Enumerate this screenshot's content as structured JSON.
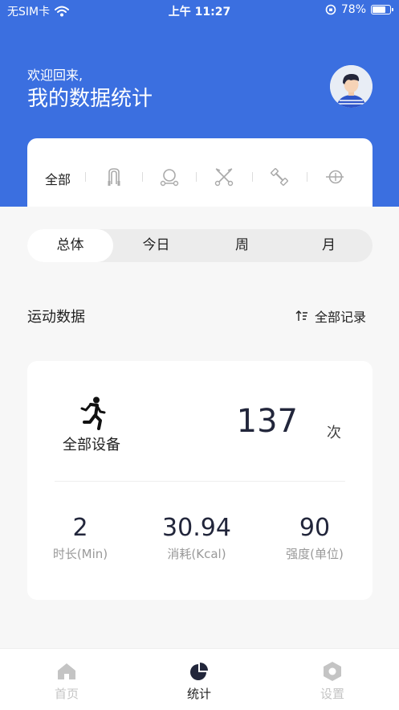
{
  "status_bar": {
    "carrier": "无SIM卡",
    "time": "上午 11:27",
    "battery": "78%",
    "battery_level": 0.78
  },
  "header": {
    "welcome": "欢迎回来,",
    "title": "我的数据统计"
  },
  "categories": {
    "all": "全部",
    "icons": [
      "jump-rope-icon",
      "bar-icon",
      "crossed-bars-icon",
      "dumbbell-icon",
      "weight-plate-icon"
    ]
  },
  "period_tabs": [
    "总体",
    "今日",
    "周",
    "月"
  ],
  "selected_period": "总体",
  "section": {
    "title": "运动数据",
    "all_records": "全部记录"
  },
  "summary": {
    "device_label": "全部设备",
    "count": "137",
    "count_unit": "次",
    "metrics": [
      {
        "value": "2",
        "label": "时长(Min)"
      },
      {
        "value": "30.94",
        "label": "消耗(Kcal)"
      },
      {
        "value": "90",
        "label": "强度(单位)"
      }
    ]
  },
  "tabbar": [
    {
      "label": "首页",
      "icon": "home-icon",
      "active": false
    },
    {
      "label": "统计",
      "icon": "pie-chart-icon",
      "active": true
    },
    {
      "label": "设置",
      "icon": "gear-icon",
      "active": false
    }
  ],
  "colors": {
    "primary": "#3b6fe0",
    "dark_text": "#22263b",
    "muted": "#999999",
    "inactive_tab": "#c4c4c4"
  }
}
